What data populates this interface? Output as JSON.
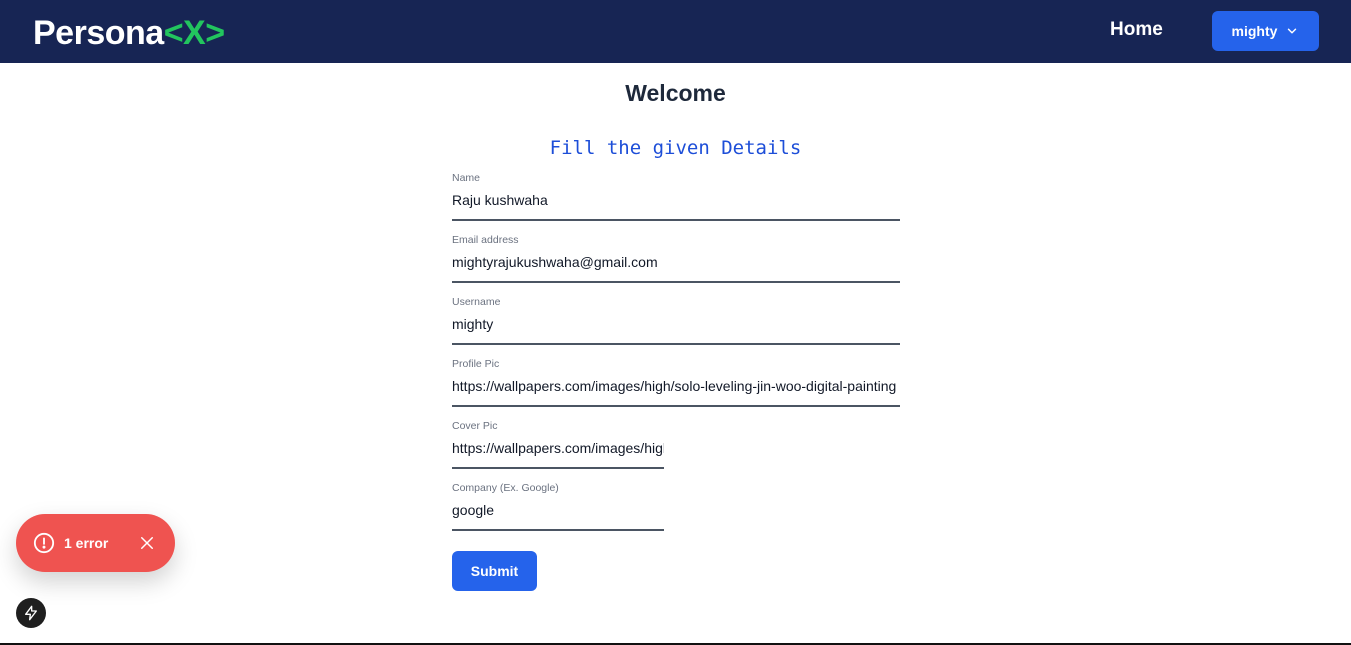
{
  "brand": {
    "name": "Persona",
    "accent": "<X>"
  },
  "nav": {
    "home": "Home",
    "user": "mighty"
  },
  "page": {
    "title": "Welcome",
    "subtitle": "Fill the given Details"
  },
  "form": {
    "name": {
      "label": "Name",
      "value": "Raju kushwaha"
    },
    "email": {
      "label": "Email address",
      "value": "mightyrajukushwaha@gmail.com"
    },
    "username": {
      "label": "Username",
      "value": "mighty"
    },
    "profile_pic": {
      "label": "Profile Pic",
      "value": "https://wallpapers.com/images/high/solo-leveling-jin-woo-digital-painting"
    },
    "cover_pic": {
      "label": "Cover Pic",
      "value": "https://wallpapers.com/images/high"
    },
    "company": {
      "label": "Company (Ex. Google)",
      "value": "google"
    },
    "submit": "Submit"
  },
  "toast": {
    "text": "1 error"
  },
  "colors": {
    "navbar": "#172554",
    "accent_green": "#22c55e",
    "primary": "#2563eb",
    "error": "#ef5350"
  },
  "icons": {
    "dropdown": "chevron-down-icon",
    "toast": "alert-circle-icon",
    "close": "close-icon",
    "devtools": "lightning-icon"
  }
}
